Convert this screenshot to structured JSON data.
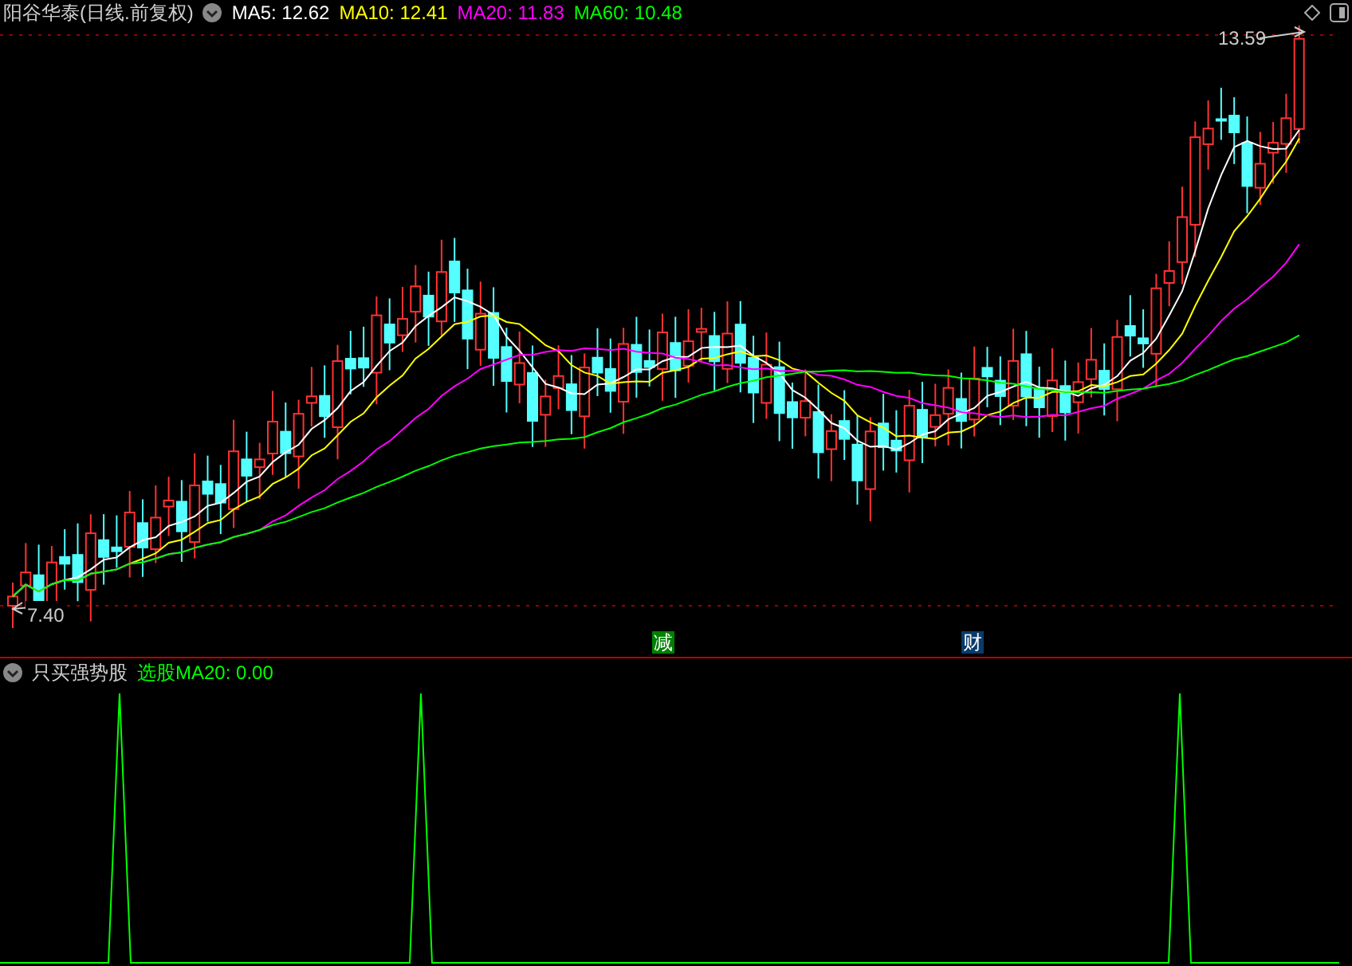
{
  "main_panel": {
    "title": "阳谷华泰(日线.前复权)",
    "indicators": [
      {
        "label": "MA5: 12.62",
        "color": "#ffffff"
      },
      {
        "label": "MA10: 12.41",
        "color": "#ffff00"
      },
      {
        "label": "MA20: 11.83",
        "color": "#ff00ff"
      },
      {
        "label": "MA60: 10.48",
        "color": "#00ff00"
      }
    ],
    "high_label": "13.59",
    "low_label": "7.40",
    "event_markers": [
      {
        "label": "减",
        "color": "#008000"
      },
      {
        "label": "财",
        "color": "#0a3a6a"
      }
    ]
  },
  "sub_panel": {
    "title": "只买强势股",
    "indicators": [
      {
        "label": "选股MA20: 0.00",
        "color": "#00ff00"
      }
    ]
  }
}
